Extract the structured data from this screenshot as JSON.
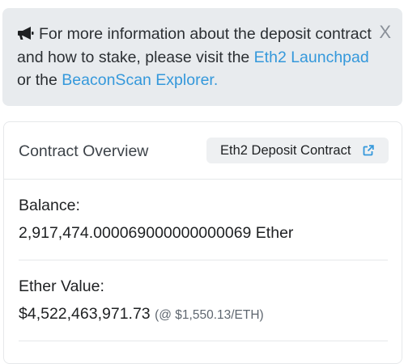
{
  "alert": {
    "text_before": "For more information about the deposit contract and how to stake, please visit the ",
    "link_launchpad": "Eth2 Launchpad",
    "text_middle": " or the ",
    "link_beaconscan": "BeaconScan Explorer.",
    "close_label": "X",
    "icon": "megaphone-icon"
  },
  "overview": {
    "title": "Contract Overview",
    "deposit_button_label": "Eth2 Deposit Contract",
    "deposit_button_icon": "external-link-icon"
  },
  "balance": {
    "label": "Balance:",
    "value": "2,917,474.000069000000000069 Ether"
  },
  "ether_value": {
    "label": "Ether Value:",
    "value": "$4,522,463,971.73",
    "rate": "(@ $1,550.13/ETH)"
  },
  "colors": {
    "link": "#3498db",
    "alert_bg": "#e8ebee"
  }
}
